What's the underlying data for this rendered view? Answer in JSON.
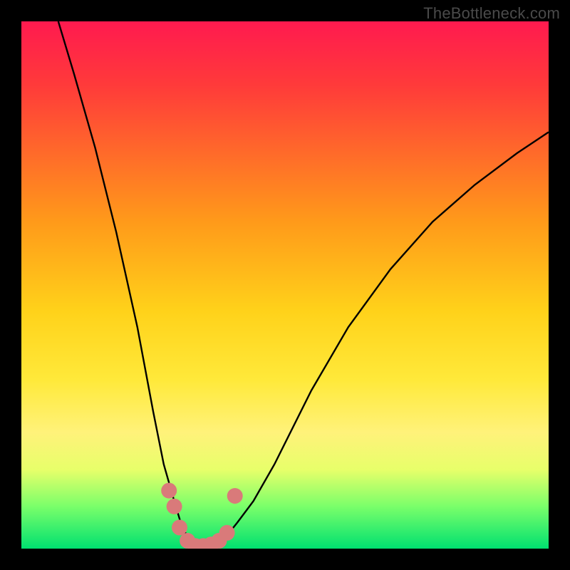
{
  "watermark": "TheBottleneck.com",
  "chart_data": {
    "type": "line",
    "title": "",
    "xlabel": "",
    "ylabel": "",
    "xlim": [
      0,
      100
    ],
    "ylim": [
      0,
      100
    ],
    "grid": false,
    "legend": false,
    "series": [
      {
        "name": "bottleneck-curve",
        "color": "#000000",
        "x": [
          7,
          10,
          14,
          18,
          22,
          25,
          27,
          29,
          30.5,
          32,
          33.5,
          35,
          37,
          39,
          41,
          44,
          48,
          55,
          62,
          70,
          78,
          86,
          94,
          100
        ],
        "y": [
          100,
          90,
          76,
          60,
          42,
          26,
          16,
          9,
          4,
          1.5,
          0.5,
          0.5,
          1,
          2.5,
          5,
          9,
          16,
          30,
          42,
          53,
          62,
          69,
          75,
          79
        ]
      },
      {
        "name": "highlight-dots",
        "color": "#d97a7a",
        "type": "scatter",
        "x": [
          28,
          29,
          30,
          31.5,
          33,
          34.5,
          36,
          37.5,
          39,
          40.5
        ],
        "y": [
          11,
          8,
          4,
          1.5,
          0.5,
          0.5,
          0.8,
          1.5,
          3,
          10
        ]
      }
    ]
  }
}
